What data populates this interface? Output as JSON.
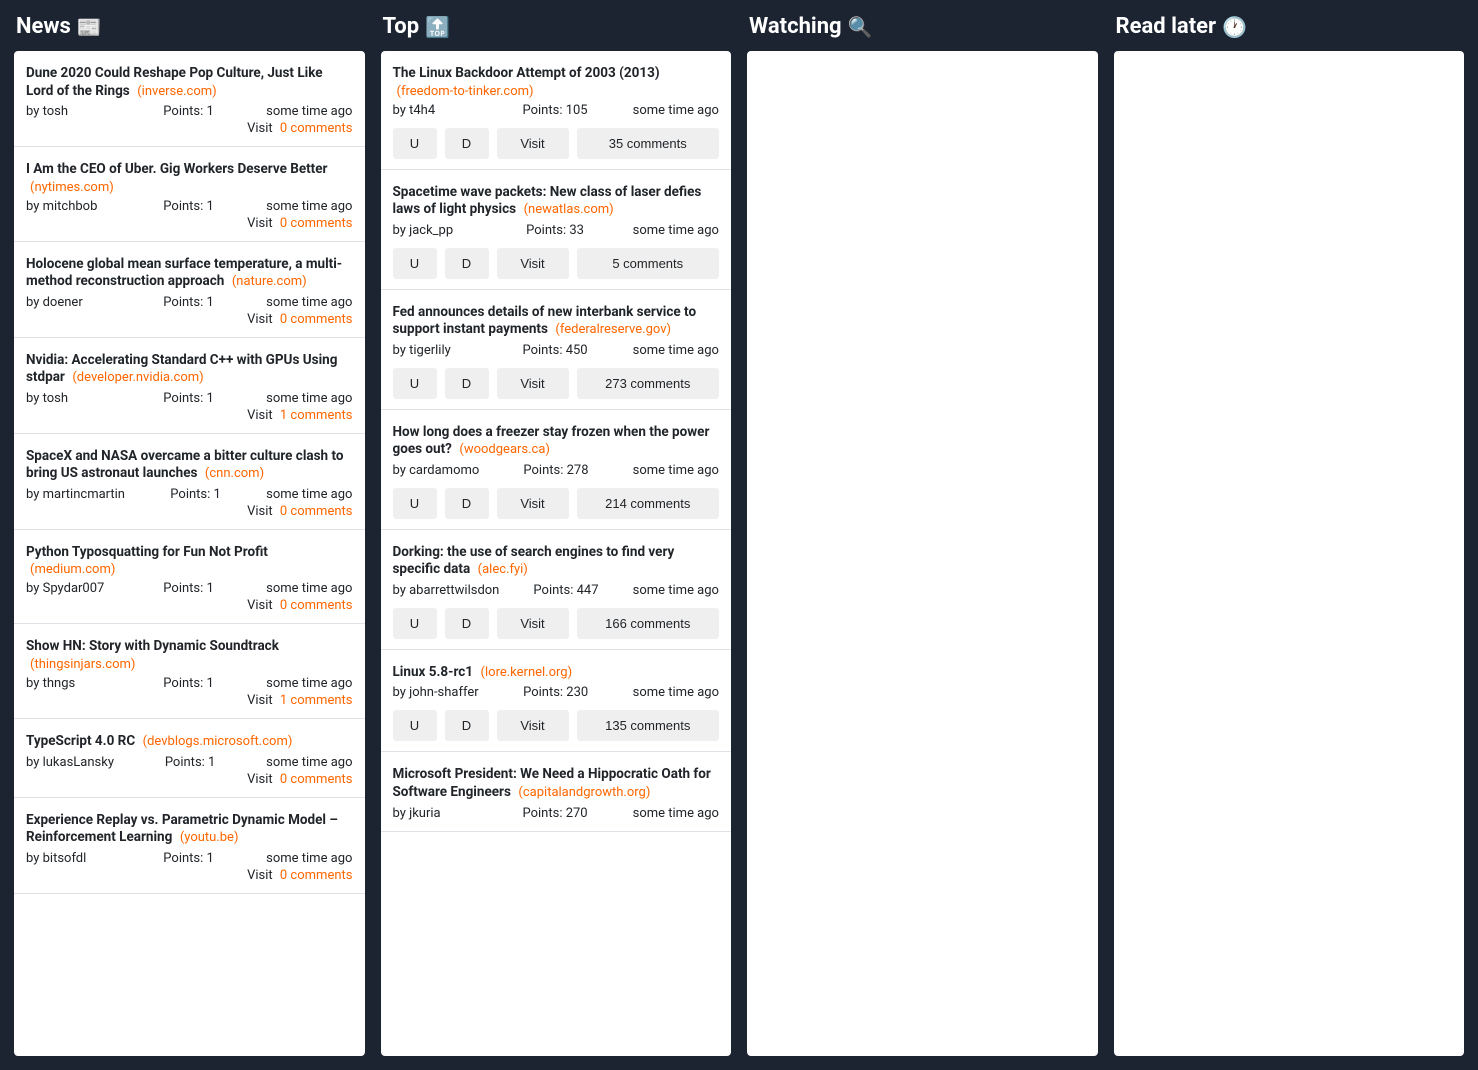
{
  "columns": {
    "news": {
      "title": "News",
      "icon": "📰"
    },
    "top": {
      "title": "Top",
      "icon": "🔝"
    },
    "watching": {
      "title": "Watching",
      "icon": "🔍"
    },
    "readlater": {
      "title": "Read later",
      "icon": "🕐"
    }
  },
  "labels": {
    "visit": "Visit",
    "upvote": "U",
    "downvote": "D",
    "by": "by",
    "points": "Points:"
  },
  "news_items": [
    {
      "title": "Dune 2020 Could Reshape Pop Culture, Just Like Lord of the Rings",
      "domain": "(inverse.com)",
      "author": "tosh",
      "points": "1",
      "time": "some time ago",
      "comments": "0 comments"
    },
    {
      "title": "I Am the CEO of Uber. Gig Workers Deserve Better",
      "domain": "(nytimes.com)",
      "author": "mitchbob",
      "points": "1",
      "time": "some time ago",
      "comments": "0 comments"
    },
    {
      "title": "Holocene global mean surface temperature, a multi-method reconstruction approach",
      "domain": "(nature.com)",
      "author": "doener",
      "points": "1",
      "time": "some time ago",
      "comments": "0 comments"
    },
    {
      "title": "Nvidia: Accelerating Standard C++ with GPUs Using stdpar",
      "domain": "(developer.nvidia.com)",
      "author": "tosh",
      "points": "1",
      "time": "some time ago",
      "comments": "1 comments"
    },
    {
      "title": "SpaceX and NASA overcame a bitter culture clash to bring US astronaut launches",
      "domain": "(cnn.com)",
      "author": "martincmartin",
      "points": "1",
      "time": "some time ago",
      "comments": "0 comments"
    },
    {
      "title": "Python Typosquatting for Fun Not Profit",
      "domain": "(medium.com)",
      "author": "Spydar007",
      "points": "1",
      "time": "some time ago",
      "comments": "0 comments"
    },
    {
      "title": "Show HN: Story with Dynamic Soundtrack",
      "domain": "(thingsinjars.com)",
      "author": "thngs",
      "points": "1",
      "time": "some time ago",
      "comments": "1 comments"
    },
    {
      "title": "TypeScript 4.0 RC",
      "domain": "(devblogs.microsoft.com)",
      "author": "lukasLansky",
      "points": "1",
      "time": "some time ago",
      "comments": "0 comments"
    },
    {
      "title": "Experience Replay vs. Parametric Dynamic Model – Reinforcement Learning",
      "domain": "(youtu.be)",
      "author": "bitsofdl",
      "points": "1",
      "time": "some time ago",
      "comments": "0 comments"
    }
  ],
  "top_items": [
    {
      "title": "The Linux Backdoor Attempt of 2003 (2013)",
      "domain": "(freedom-to-tinker.com)",
      "author": "t4h4",
      "points": "105",
      "time": "some time ago",
      "comments": "35 comments"
    },
    {
      "title": "Spacetime wave packets: New class of laser defies laws of light physics",
      "domain": "(newatlas.com)",
      "author": "jack_pp",
      "points": "33",
      "time": "some time ago",
      "comments": "5 comments"
    },
    {
      "title": "Fed announces details of new interbank service to support instant payments",
      "domain": "(federalreserve.gov)",
      "author": "tigerlily",
      "points": "450",
      "time": "some time ago",
      "comments": "273 comments"
    },
    {
      "title": "How long does a freezer stay frozen when the power goes out?",
      "domain": "(woodgears.ca)",
      "author": "cardamomo",
      "points": "278",
      "time": "some time ago",
      "comments": "214 comments"
    },
    {
      "title": "Dorking: the use of search engines to find very specific data",
      "domain": "(alec.fyi)",
      "author": "abarrettwilsdon",
      "points": "447",
      "time": "some time ago",
      "comments": "166 comments"
    },
    {
      "title": "Linux 5.8-rc1",
      "domain": "(lore.kernel.org)",
      "author": "john-shaffer",
      "points": "230",
      "time": "some time ago",
      "comments": "135 comments"
    },
    {
      "title": "Microsoft President: We Need a Hippocratic Oath for Software Engineers",
      "domain": "(capitalandgrowth.org)",
      "author": "jkuria",
      "points": "270",
      "time": "some time ago",
      "comments": ""
    }
  ]
}
